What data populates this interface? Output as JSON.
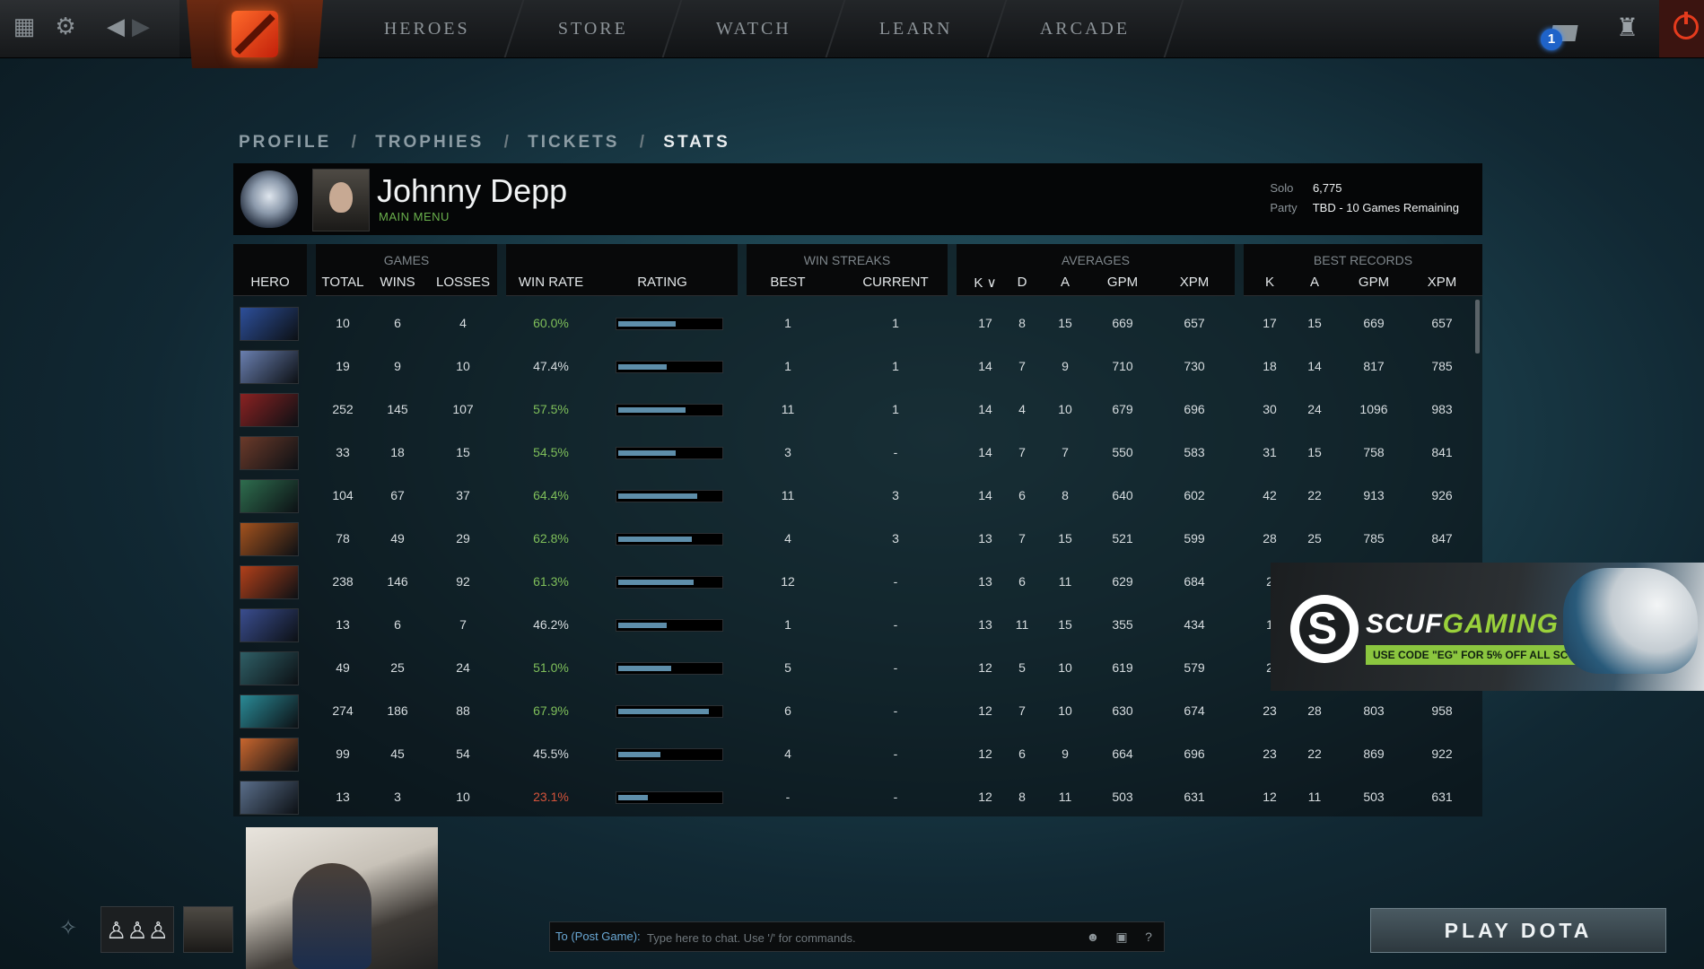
{
  "nav": {
    "items": [
      "HEROES",
      "STORE",
      "WATCH",
      "LEARN",
      "ARCADE"
    ]
  },
  "notifications": {
    "count": "1"
  },
  "breadcrumb": {
    "profile": "PROFILE",
    "trophies": "TROPHIES",
    "tickets": "TICKETS",
    "stats": "STATS",
    "separator": "/"
  },
  "profile": {
    "name": "Johnny Depp",
    "subtitle": "MAIN MENU",
    "solo_label": "Solo",
    "solo_value": "6,775",
    "party_label": "Party",
    "party_value": "TBD - 10 Games Remaining"
  },
  "table": {
    "groups": {
      "games": "GAMES",
      "win_streaks": "WIN STREAKS",
      "averages": "AVERAGES",
      "best_records": "BEST RECORDS"
    },
    "headers": {
      "hero": "HERO",
      "total": "TOTAL",
      "wins": "WINS",
      "losses": "LOSSES",
      "win_rate": "WIN RATE",
      "rating": "RATING",
      "best": "BEST",
      "current": "CURRENT",
      "avg_k": "K ∨",
      "avg_d": "D",
      "avg_a": "A",
      "avg_gpm": "GPM",
      "avg_xpm": "XPM",
      "best_k": "K",
      "best_a": "A",
      "best_gpm": "GPM",
      "best_xpm": "XPM"
    },
    "rows": [
      {
        "hero_color": "#2d4f9a",
        "total": "10",
        "wins": "6",
        "losses": "4",
        "win_rate": "60.0%",
        "rating": 0.56,
        "best": "1",
        "current": "1",
        "k": "17",
        "d": "8",
        "a": "15",
        "gpm": "669",
        "xpm": "657",
        "bk": "17",
        "ba": "15",
        "bgpm": "669",
        "bxpm": "657"
      },
      {
        "hero_color": "#6a7fb0",
        "total": "19",
        "wins": "9",
        "losses": "10",
        "win_rate": "47.4%",
        "rating": 0.47,
        "best": "1",
        "current": "1",
        "k": "14",
        "d": "7",
        "a": "9",
        "gpm": "710",
        "xpm": "730",
        "bk": "18",
        "ba": "14",
        "bgpm": "817",
        "bxpm": "785"
      },
      {
        "hero_color": "#8a2222",
        "total": "252",
        "wins": "145",
        "losses": "107",
        "win_rate": "57.5%",
        "rating": 0.66,
        "best": "11",
        "current": "1",
        "k": "14",
        "d": "4",
        "a": "10",
        "gpm": "679",
        "xpm": "696",
        "bk": "30",
        "ba": "24",
        "bgpm": "1096",
        "bxpm": "983"
      },
      {
        "hero_color": "#6b3a2a",
        "total": "33",
        "wins": "18",
        "losses": "15",
        "win_rate": "54.5%",
        "rating": 0.56,
        "best": "3",
        "current": "-",
        "k": "14",
        "d": "7",
        "a": "7",
        "gpm": "550",
        "xpm": "583",
        "bk": "31",
        "ba": "15",
        "bgpm": "758",
        "bxpm": "841"
      },
      {
        "hero_color": "#2e6d4e",
        "total": "104",
        "wins": "67",
        "losses": "37",
        "win_rate": "64.4%",
        "rating": 0.77,
        "best": "11",
        "current": "3",
        "k": "14",
        "d": "6",
        "a": "8",
        "gpm": "640",
        "xpm": "602",
        "bk": "42",
        "ba": "22",
        "bgpm": "913",
        "bxpm": "926"
      },
      {
        "hero_color": "#a3521e",
        "total": "78",
        "wins": "49",
        "losses": "29",
        "win_rate": "62.8%",
        "rating": 0.72,
        "best": "4",
        "current": "3",
        "k": "13",
        "d": "7",
        "a": "15",
        "gpm": "521",
        "xpm": "599",
        "bk": "28",
        "ba": "25",
        "bgpm": "785",
        "bxpm": "847"
      },
      {
        "hero_color": "#b2401a",
        "total": "238",
        "wins": "146",
        "losses": "92",
        "win_rate": "61.3%",
        "rating": 0.74,
        "best": "12",
        "current": "-",
        "k": "13",
        "d": "6",
        "a": "11",
        "gpm": "629",
        "xpm": "684",
        "bk": "2",
        "ba": "",
        "bgpm": "",
        "bxpm": ""
      },
      {
        "hero_color": "#3a4d8f",
        "total": "13",
        "wins": "6",
        "losses": "7",
        "win_rate": "46.2%",
        "rating": 0.47,
        "best": "1",
        "current": "-",
        "k": "13",
        "d": "11",
        "a": "15",
        "gpm": "355",
        "xpm": "434",
        "bk": "1",
        "ba": "",
        "bgpm": "",
        "bxpm": ""
      },
      {
        "hero_color": "#2f5f66",
        "total": "49",
        "wins": "25",
        "losses": "24",
        "win_rate": "51.0%",
        "rating": 0.52,
        "best": "5",
        "current": "-",
        "k": "12",
        "d": "5",
        "a": "10",
        "gpm": "619",
        "xpm": "579",
        "bk": "2",
        "ba": "",
        "bgpm": "",
        "bxpm": ""
      },
      {
        "hero_color": "#2a8a96",
        "total": "274",
        "wins": "186",
        "losses": "88",
        "win_rate": "67.9%",
        "rating": 0.89,
        "best": "6",
        "current": "-",
        "k": "12",
        "d": "7",
        "a": "10",
        "gpm": "630",
        "xpm": "674",
        "bk": "23",
        "ba": "28",
        "bgpm": "803",
        "bxpm": "958"
      },
      {
        "hero_color": "#c9662e",
        "total": "99",
        "wins": "45",
        "losses": "54",
        "win_rate": "45.5%",
        "rating": 0.41,
        "best": "4",
        "current": "-",
        "k": "12",
        "d": "6",
        "a": "9",
        "gpm": "664",
        "xpm": "696",
        "bk": "23",
        "ba": "22",
        "bgpm": "869",
        "bxpm": "922"
      },
      {
        "hero_color": "#5a6e8a",
        "total": "13",
        "wins": "3",
        "losses": "10",
        "win_rate": "23.1%",
        "rating": 0.29,
        "best": "-",
        "current": "-",
        "k": "12",
        "d": "8",
        "a": "11",
        "gpm": "503",
        "xpm": "631",
        "bk": "12",
        "ba": "11",
        "bgpm": "503",
        "bxpm": "631"
      }
    ]
  },
  "ad": {
    "logo_letter": "S",
    "brand_white": "SCUF",
    "brand_green": "GAMING",
    "code": "USE CODE \"EG\" FOR 5% OFF ALL SCUF PURCHASES"
  },
  "chat": {
    "to_label": "To (Post Game):",
    "placeholder": "Type here to chat. Use '/' for commands.",
    "help": "?"
  },
  "play_button": "PLAY DOTA",
  "colors": {
    "win_good": "#7fbf5a",
    "win_bad": "#d4533b",
    "rating_bar": "#5e8eaa",
    "accent_green": "#6ab04c"
  }
}
